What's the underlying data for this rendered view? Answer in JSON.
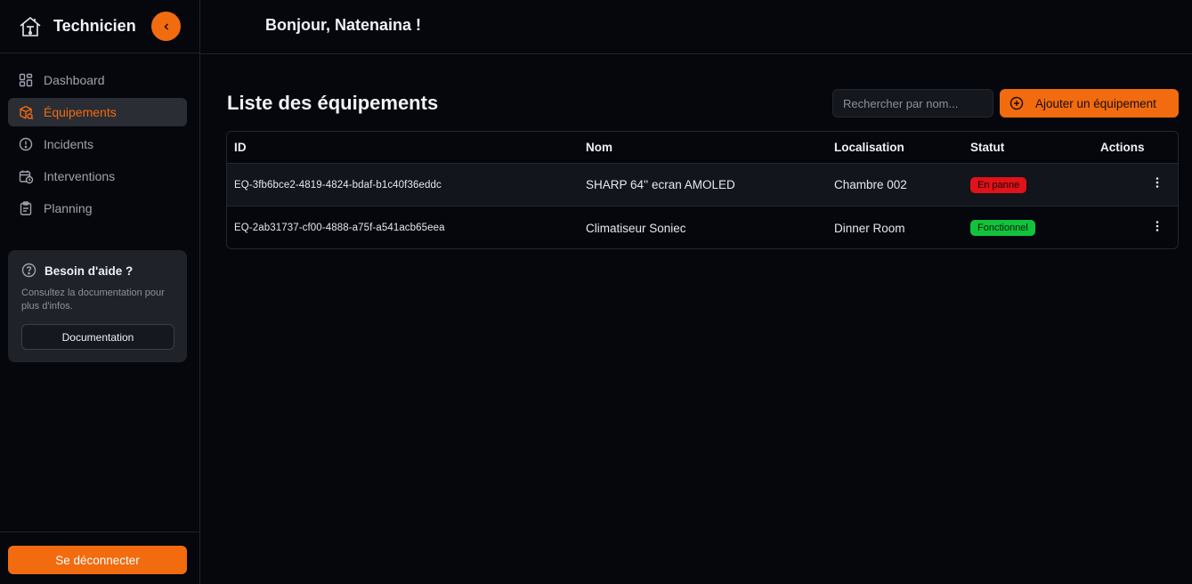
{
  "brand": {
    "title": "Technicien",
    "accent": "#f26b0f"
  },
  "sidebar": {
    "items": [
      {
        "label": "Dashboard",
        "icon": "grid-icon"
      },
      {
        "label": "Équipements",
        "icon": "package-icon"
      },
      {
        "label": "Incidents",
        "icon": "alert-circle-icon"
      },
      {
        "label": "Interventions",
        "icon": "calendar-clock-icon"
      },
      {
        "label": "Planning",
        "icon": "clipboard-icon"
      }
    ],
    "active_index": 1,
    "help": {
      "title": "Besoin d'aide ?",
      "text": "Consultez la documentation pour plus d'infos.",
      "button": "Documentation"
    },
    "logout": "Se déconnecter"
  },
  "header": {
    "greeting": "Bonjour, Natenaina !"
  },
  "main": {
    "title": "Liste des équipements",
    "search": {
      "placeholder": "Rechercher par nom...",
      "value": ""
    },
    "add_button": "Ajouter un équipement",
    "table": {
      "columns": [
        "ID",
        "Nom",
        "Localisation",
        "Statut",
        "Actions"
      ],
      "rows": [
        {
          "id": "EQ-3fb6bce2-4819-4824-bdaf-b1c40f36eddc",
          "nom": "SHARP 64'' ecran AMOLED",
          "localisation": "Chambre 002",
          "statut": "En panne",
          "statut_color": "#e0121a"
        },
        {
          "id": "EQ-2ab31737-cf00-4888-a75f-a541acb65eea",
          "nom": "Climatiseur Soniec",
          "localisation": "Dinner Room",
          "statut": "Fonctionnel",
          "statut_color": "#12c23c"
        }
      ]
    }
  }
}
